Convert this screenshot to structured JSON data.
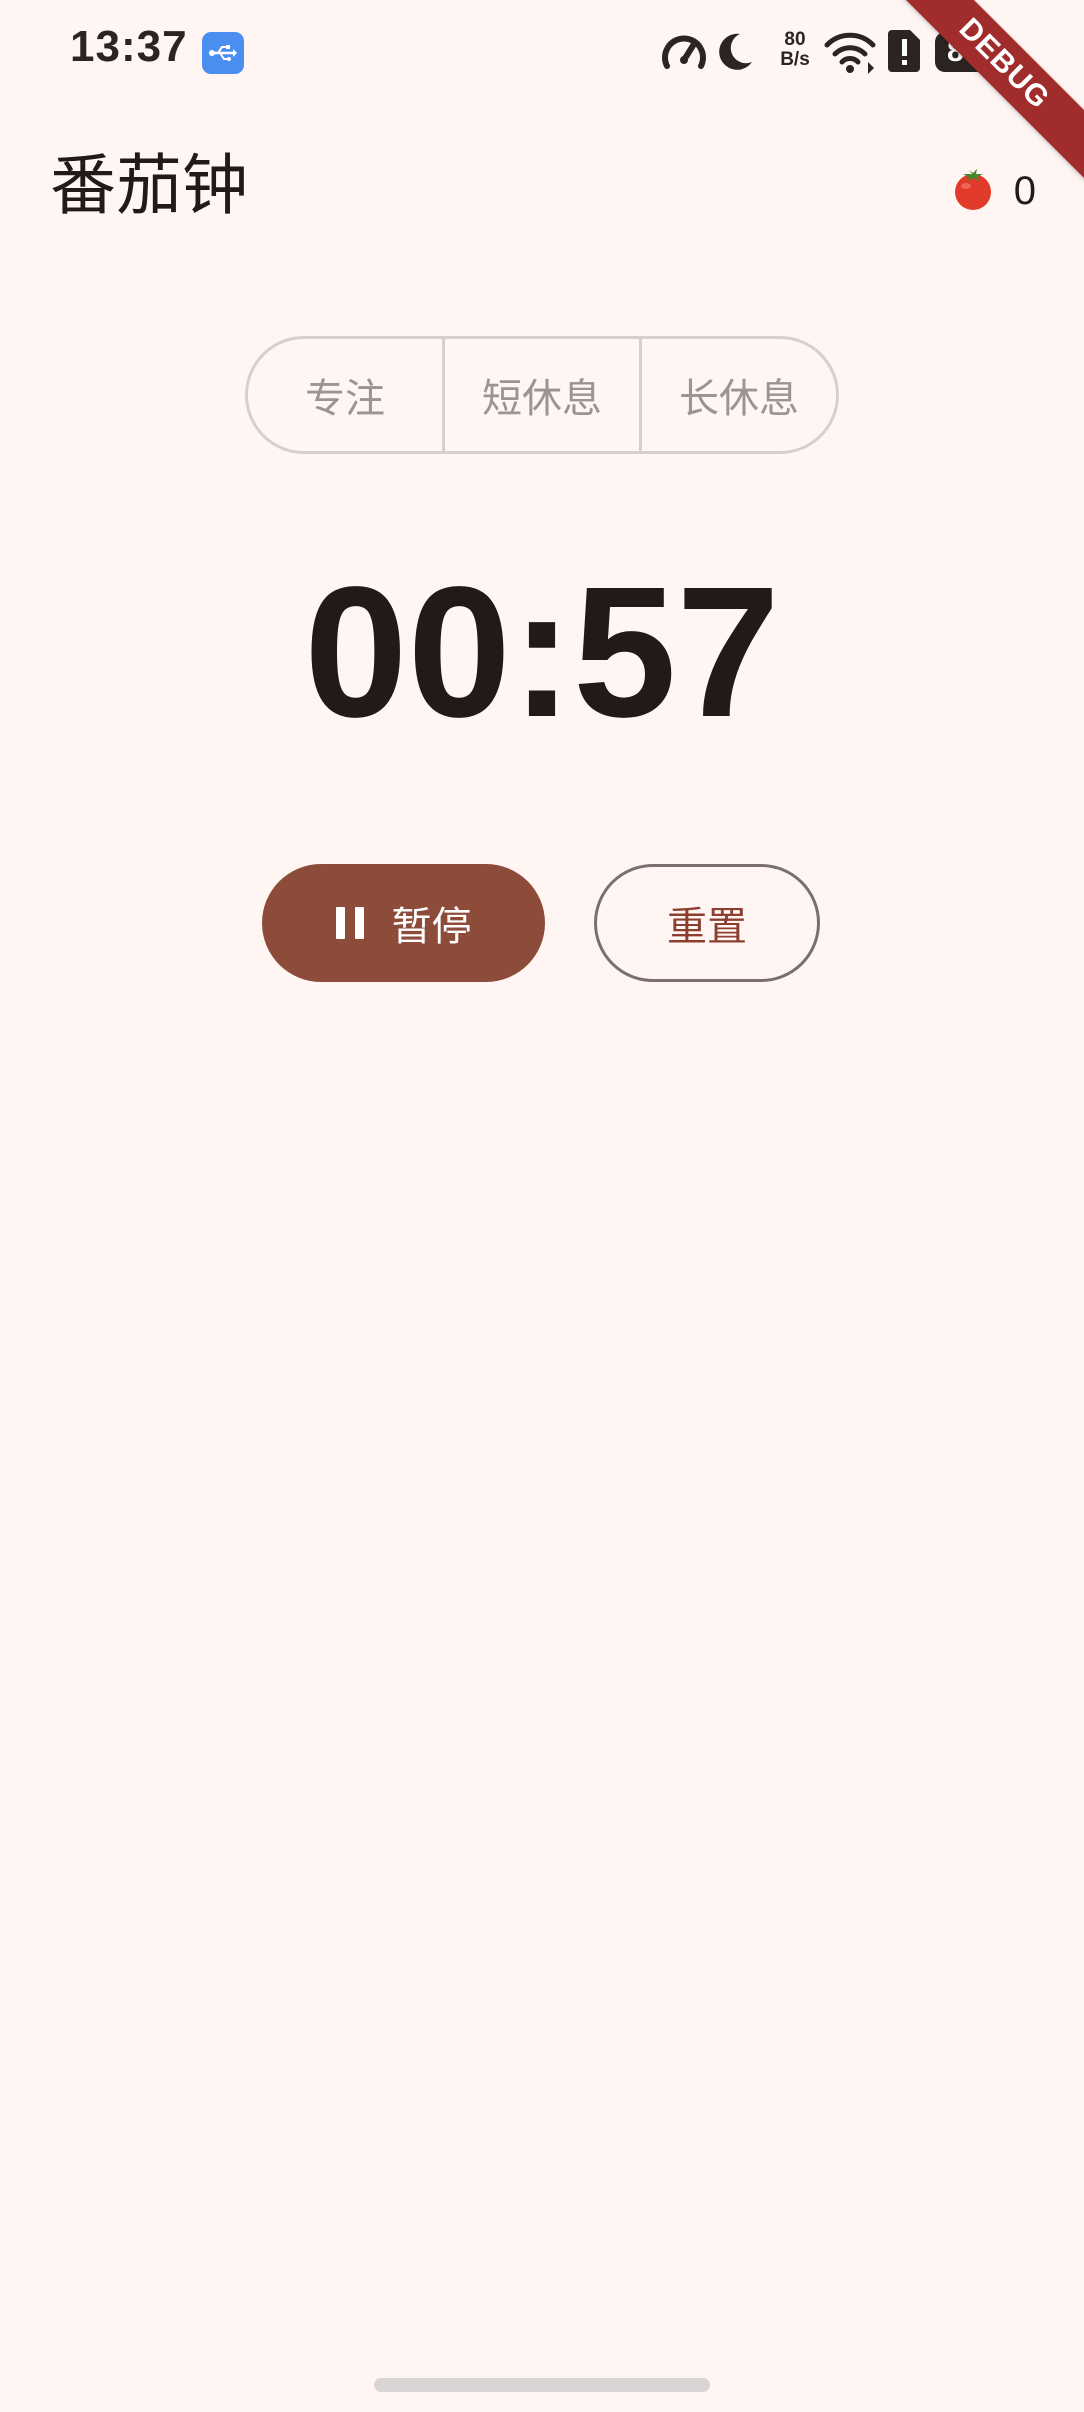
{
  "status_bar": {
    "time": "13:37",
    "net_speed_value": "80",
    "net_speed_unit": "B/s",
    "battery_level": "85",
    "icons": [
      "usb-icon",
      "speed-gauge-icon",
      "moon-icon",
      "wifi-icon",
      "alert-icon",
      "battery-icon"
    ]
  },
  "debug_banner": "DEBUG",
  "app_bar": {
    "title": "番茄钟",
    "counter_icon": "tomato-icon",
    "counter_value": "0"
  },
  "mode_selector": {
    "options": [
      "专注",
      "短休息",
      "长休息"
    ]
  },
  "timer": {
    "display": "00:57"
  },
  "controls": {
    "pause_label": "暂停",
    "pause_icon": "pause-icon",
    "reset_label": "重置"
  },
  "colors": {
    "background": "#fff6f4",
    "primary": "#8d4b3a",
    "reset_text": "#8d3f2f",
    "text": "#231a18",
    "muted_text": "#9c9392",
    "outline": "#d8cfcd",
    "usb_badge": "#4a8ff0",
    "debug_ribbon": "#a02c2c"
  }
}
